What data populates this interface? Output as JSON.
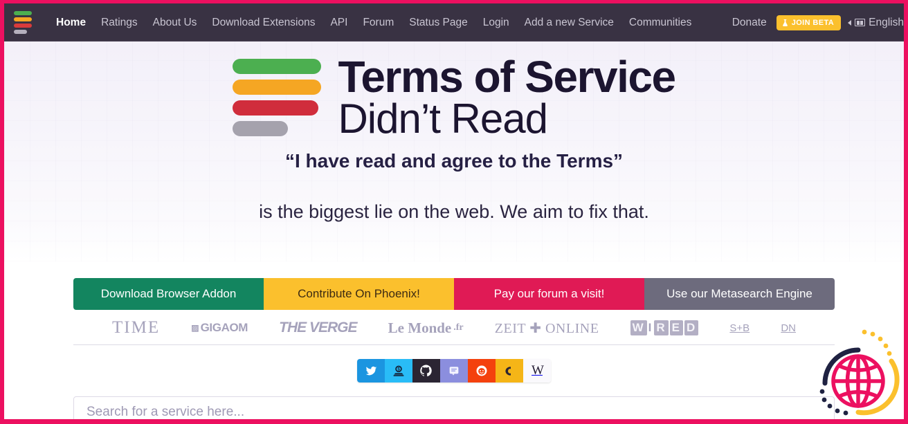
{
  "brand": {
    "logo_icon": "tosdr-bars-logo",
    "bar_colors": [
      "#4caf50",
      "#f5a623",
      "#d93b3b",
      "#b5b0bd"
    ]
  },
  "nav": {
    "items": [
      {
        "label": "Home",
        "active": true
      },
      {
        "label": "Ratings",
        "active": false
      },
      {
        "label": "About Us",
        "active": false
      },
      {
        "label": "Download Extensions",
        "active": false
      },
      {
        "label": "API",
        "active": false
      },
      {
        "label": "Forum",
        "active": false
      },
      {
        "label": "Status Page",
        "active": false
      },
      {
        "label": "Login",
        "active": false
      },
      {
        "label": "Add a new Service",
        "active": false
      },
      {
        "label": "Communities",
        "active": false
      }
    ],
    "donate_label": "Donate",
    "beta_label": "JOIN BETA",
    "beta_icon": "flask-icon",
    "beta_color": "#fbc02d",
    "language_label": "English",
    "language_caret_icon": "chevron-left-icon",
    "language_flag_icon": "flag-icon",
    "bar_color": "#393243"
  },
  "hero": {
    "title_line1": "Terms of Service",
    "title_line2": "Didn’t Read",
    "quote": "“I have read and agree to the Terms”",
    "tagline": "is the biggest lie on the web. We aim to fix that.",
    "logo_icon": "tosdr-bars-logo-large",
    "logo_bar_colors": [
      "#4caf50",
      "#f5a623",
      "#d02d3c",
      "#a5a2ad"
    ]
  },
  "cta": {
    "buttons": [
      {
        "label": "Download Browser Addon",
        "color": "#13855f"
      },
      {
        "label": "Contribute On Phoenix!",
        "color": "#fbc02d"
      },
      {
        "label": "Pay our forum a visit!",
        "color": "#e01a55"
      },
      {
        "label": "Use our Metasearch Engine",
        "color": "#6d6b7d"
      }
    ]
  },
  "press": {
    "items": [
      {
        "name": "TIME",
        "text": "TIME"
      },
      {
        "name": "GigaOM",
        "text": "GIGAOM"
      },
      {
        "name": "The Verge",
        "text": "THE VERGE"
      },
      {
        "name": "Le Monde.fr",
        "text": "Le Monde"
      },
      {
        "name": "Le Monde suffix",
        "text": ".fr"
      },
      {
        "name": "ZEIT ONLINE",
        "text": "ZEIT ✚ ONLINE"
      },
      {
        "name": "WIRED",
        "text": "WIRED"
      },
      {
        "name": "S+B",
        "text": "S+B"
      },
      {
        "name": "DN",
        "text": "DN"
      }
    ]
  },
  "social": {
    "items": [
      {
        "icon": "twitter-icon",
        "label": "Twitter",
        "color": "#1b95e0"
      },
      {
        "icon": "open-collective-icon",
        "label": "Open Collective",
        "color": "#29bcf7"
      },
      {
        "icon": "github-icon",
        "label": "GitHub",
        "color": "#2b2533"
      },
      {
        "icon": "discourse-icon",
        "label": "Discourse",
        "color": "#8b8ede"
      },
      {
        "icon": "reddit-icon",
        "label": "Reddit",
        "color": "#f4410d"
      },
      {
        "icon": "discord-icon",
        "label": "Discord",
        "color": "#f5b517"
      },
      {
        "icon": "wikipedia-icon",
        "label": "W",
        "color": "#faf9fc"
      }
    ]
  },
  "search": {
    "placeholder": "Search for a service here...",
    "value": ""
  },
  "watermark": {
    "icon": "globe-logo-watermark",
    "colors": {
      "globe": "#ec1060",
      "arc_dark": "#1f2242",
      "arc_yellow": "#fbc02d"
    }
  },
  "page": {
    "frame_color": "#ec1060",
    "background": "#ffffff"
  }
}
